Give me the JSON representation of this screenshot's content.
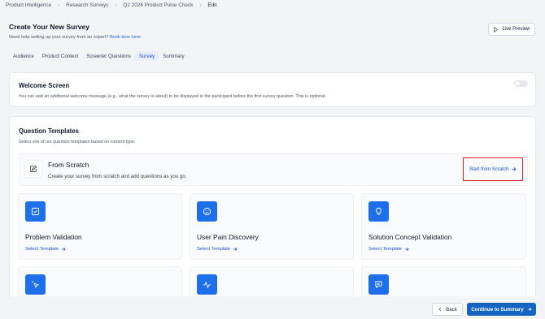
{
  "breadcrumb": {
    "items": [
      "Product Intelligence",
      "Research Surveys",
      "Q2 2026 Product Pulse Check"
    ],
    "current": "Edit"
  },
  "header": {
    "title": "Create Your New Survey",
    "help_text": "Need help setting up your survey from an expert?",
    "help_link": "Book time here.",
    "live_preview": "Live Preview"
  },
  "tabs": [
    "Audience",
    "Product Context",
    "Screener Questions",
    "Survey",
    "Summary"
  ],
  "active_tab": "Survey",
  "welcome": {
    "title": "Welcome Screen",
    "description": "You can add an additional welcome message (e.g., what the survey is about) to be displayed to the participant before the first survey question. This is optional.",
    "toggle_on": false
  },
  "templates": {
    "title": "Question Templates",
    "description": "Select one of our question templates based on content type.",
    "scratch": {
      "title": "From Scratch",
      "description": "Create your survey from scratch and add questions as you go.",
      "button": "Start from Scratch"
    },
    "cards": [
      {
        "title": "Problem Validation",
        "link": "Select Template",
        "icon": "checkbox-icon"
      },
      {
        "title": "User Pain Discovery",
        "link": "Select Template",
        "icon": "frown-face-icon"
      },
      {
        "title": "Solution Concept Validation",
        "link": "Select Template",
        "icon": "lightbulb-icon"
      },
      {
        "title": "",
        "link": "",
        "icon": "pointer-click-icon"
      },
      {
        "title": "",
        "link": "",
        "icon": "activity-icon"
      },
      {
        "title": "",
        "link": "",
        "icon": "message-icon"
      }
    ]
  },
  "footer": {
    "back": "Back",
    "continue": "Continue to Summary"
  },
  "colors": {
    "accent": "#1f6feb",
    "primary_button": "#1565c0",
    "highlight_border": "#e11d2a",
    "link": "#1d4ed8"
  }
}
